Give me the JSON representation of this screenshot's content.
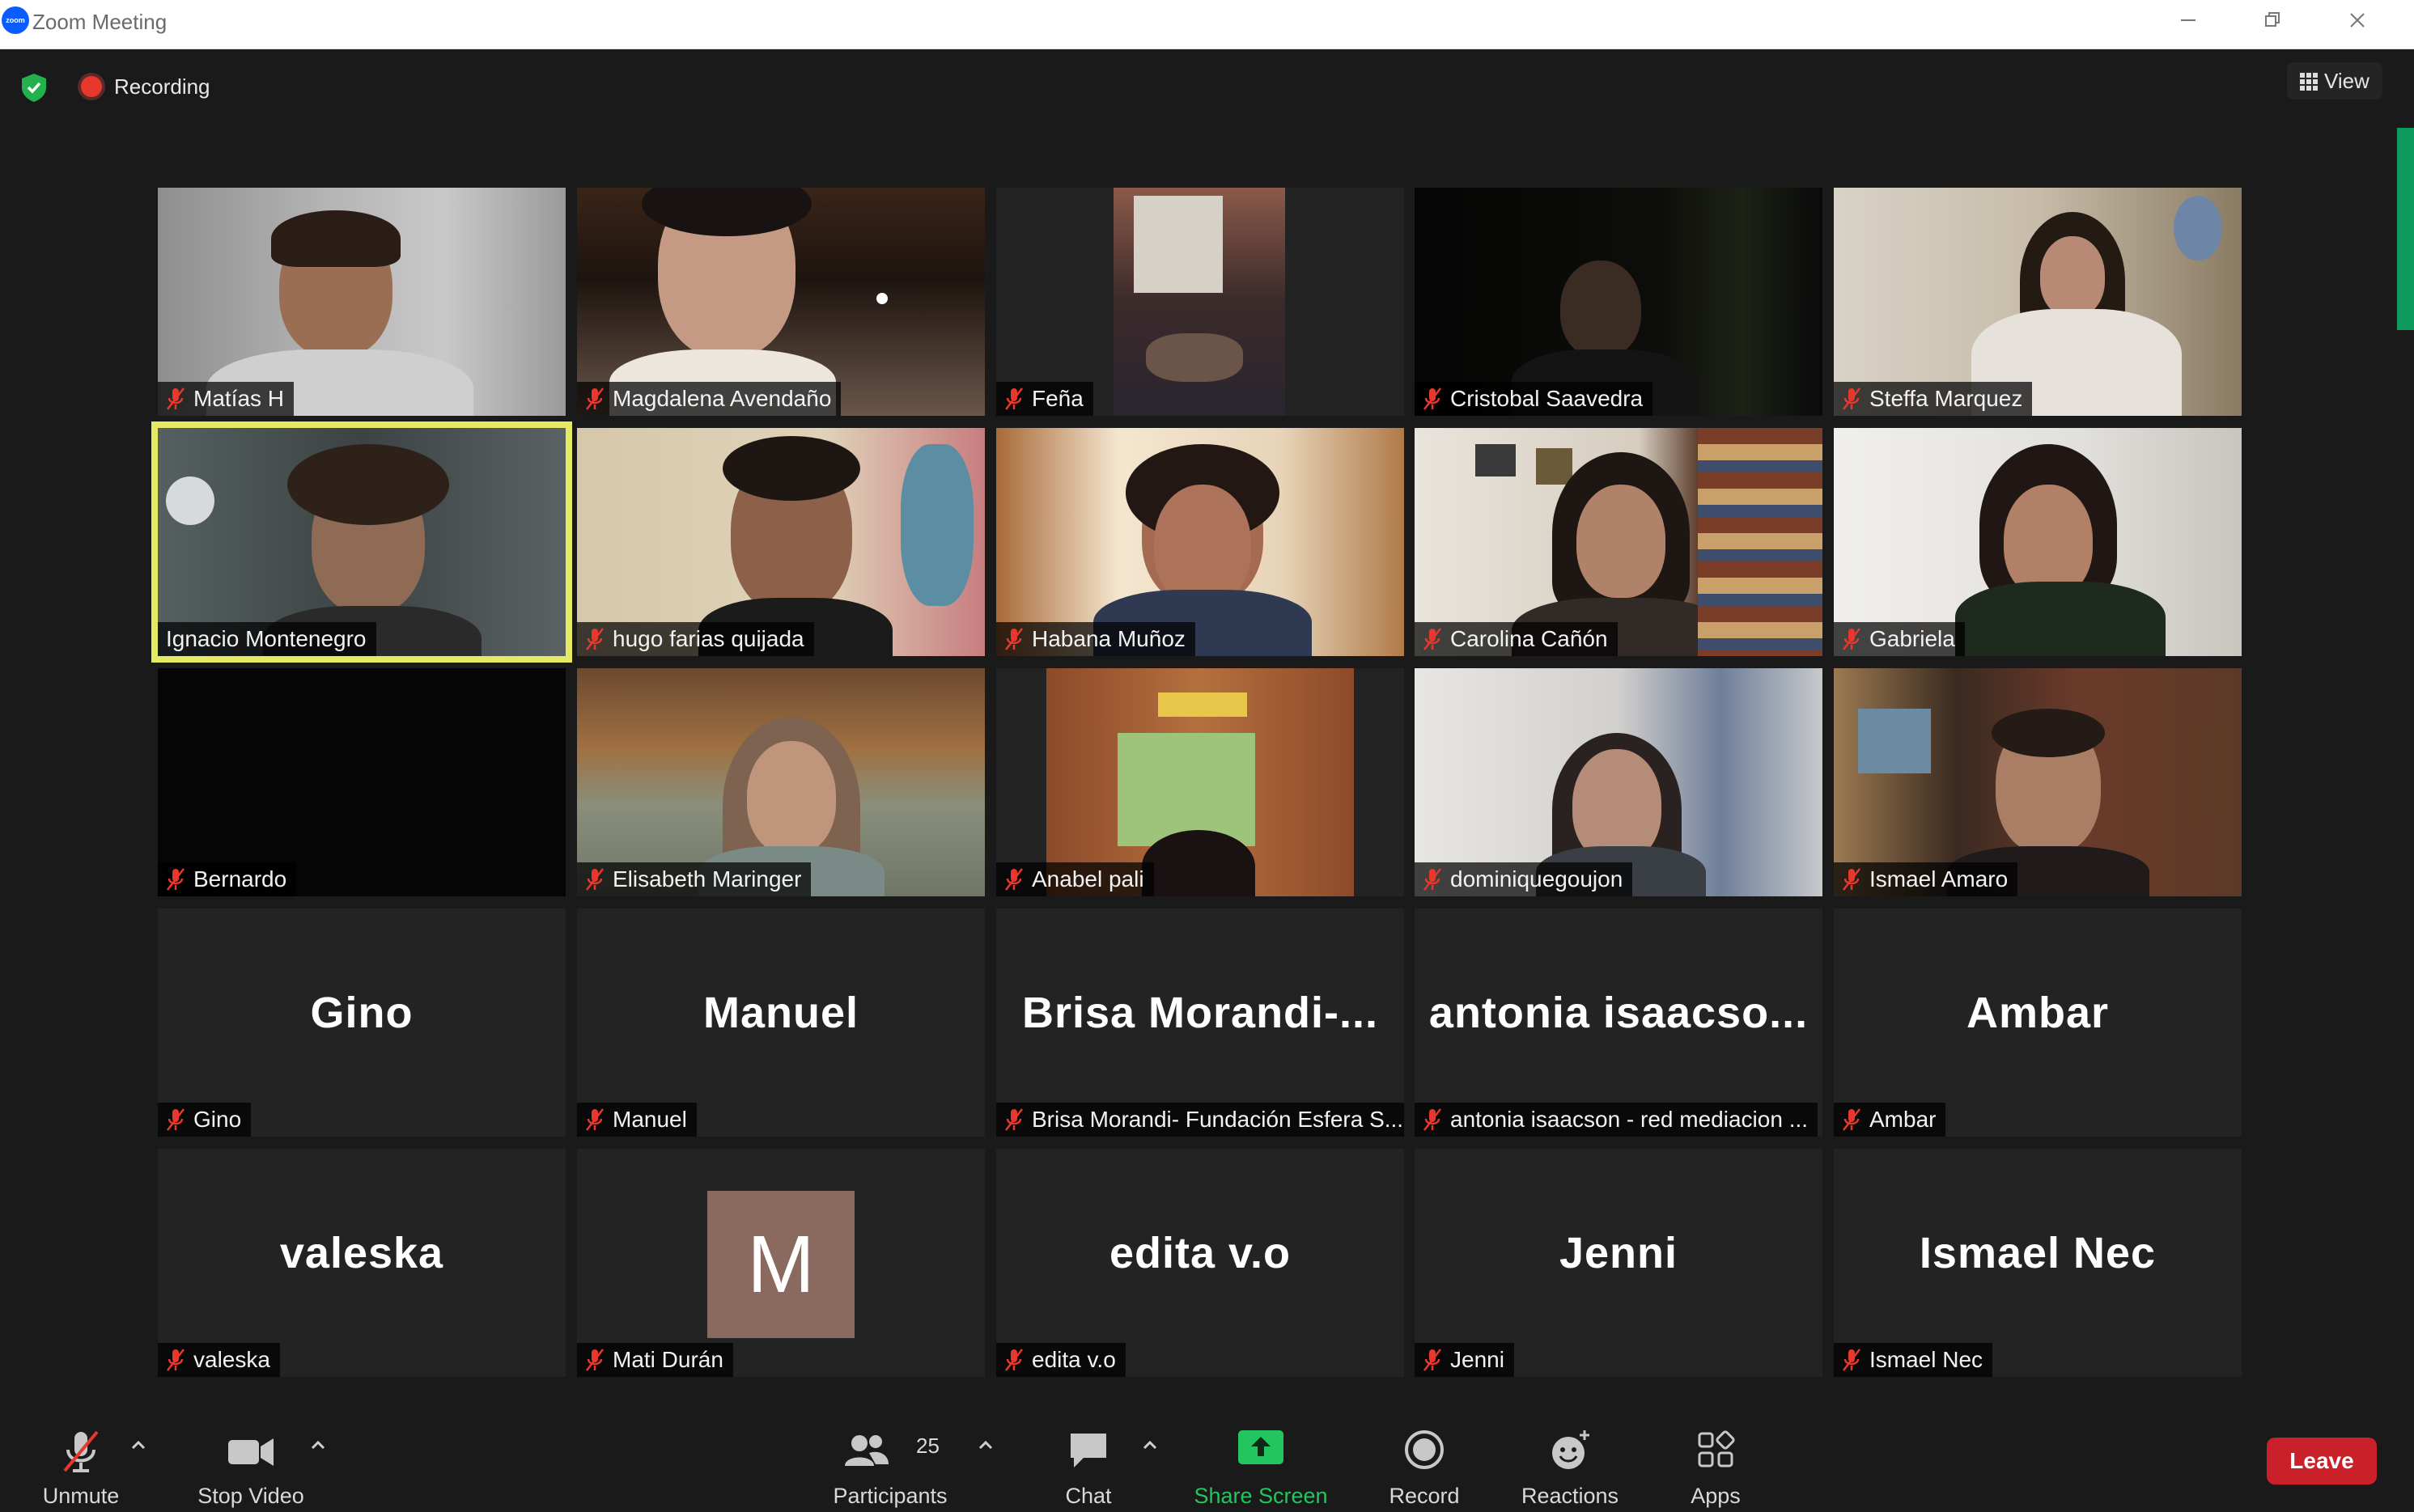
{
  "window": {
    "title": "Zoom Meeting",
    "logo_text": "zoom"
  },
  "meeting": {
    "recording_label": "Recording",
    "view_label": "View"
  },
  "participants": [
    {
      "display": "Matías H",
      "muted": true,
      "video": true
    },
    {
      "display": "Magdalena Avendaño",
      "muted": true,
      "video": true
    },
    {
      "display": "Feña",
      "muted": true,
      "video": true
    },
    {
      "display": "Cristobal Saavedra",
      "muted": true,
      "video": true
    },
    {
      "display": "Steffa Marquez",
      "muted": true,
      "video": true
    },
    {
      "display": "Ignacio Montenegro",
      "muted": false,
      "video": true,
      "speaking": true
    },
    {
      "display": "hugo farias quijada",
      "muted": true,
      "video": true
    },
    {
      "display": "Habana Muñoz",
      "muted": true,
      "video": true
    },
    {
      "display": "Carolina Cañón",
      "muted": true,
      "video": true
    },
    {
      "display": "Gabriela",
      "muted": true,
      "video": true
    },
    {
      "display": "Bernardo",
      "muted": true,
      "video": true
    },
    {
      "display": "Elisabeth Maringer",
      "muted": true,
      "video": true
    },
    {
      "display": "Anabel pali",
      "muted": true,
      "video": true
    },
    {
      "display": "dominiquegoujon",
      "muted": true,
      "video": true
    },
    {
      "display": "Ismael Amaro",
      "muted": true,
      "video": true
    },
    {
      "display": "Gino",
      "big": "Gino",
      "muted": true,
      "video": false
    },
    {
      "display": "Manuel",
      "big": "Manuel",
      "muted": true,
      "video": false
    },
    {
      "display": "Brisa Morandi- Fundación Esfera S...",
      "big": "Brisa Morandi-...",
      "muted": true,
      "video": false
    },
    {
      "display": "antonia isaacson - red mediacion ...",
      "big": "antonia isaacso...",
      "muted": true,
      "video": false
    },
    {
      "display": "Ambar",
      "big": "Ambar",
      "muted": true,
      "video": false
    },
    {
      "display": "valeska",
      "big": "valeska",
      "muted": true,
      "video": false
    },
    {
      "display": "Mati Durán",
      "avatar": "M",
      "muted": true,
      "video": false
    },
    {
      "display": "edita v.o",
      "big": "edita v.o",
      "muted": true,
      "video": false
    },
    {
      "display": "Jenni",
      "big": "Jenni",
      "muted": true,
      "video": false
    },
    {
      "display": "Ismael Nec",
      "big": "Ismael Nec",
      "muted": true,
      "video": false
    }
  ],
  "toolbar": {
    "unmute": "Unmute",
    "stop_video": "Stop Video",
    "participants": "Participants",
    "participants_count": "25",
    "chat": "Chat",
    "share_screen": "Share Screen",
    "record": "Record",
    "reactions": "Reactions",
    "apps": "Apps",
    "leave": "Leave"
  },
  "colors": {
    "active_speaker": "#e4ea63",
    "share_green": "#23c55e",
    "leave_red": "#c9202a",
    "muted_mic": "#e8372c"
  }
}
